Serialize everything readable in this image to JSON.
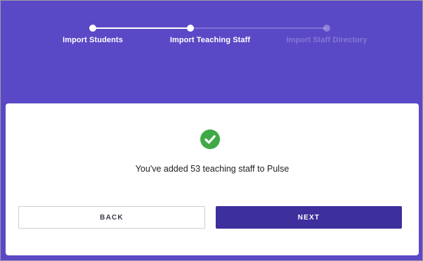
{
  "stepper": {
    "steps": [
      {
        "label": "Import Students",
        "state": "complete"
      },
      {
        "label": "Import Teaching Staff",
        "state": "current"
      },
      {
        "label": "Import Staff Directory",
        "state": "upcoming"
      }
    ]
  },
  "card": {
    "status_icon": "check-circle-icon",
    "message": "You've added 53 teaching staff to Pulse",
    "back_label": "BACK",
    "next_label": "NEXT"
  },
  "colors": {
    "background": "#5a49c6",
    "primary_button": "#3d2f9c",
    "success": "#3faa45"
  }
}
